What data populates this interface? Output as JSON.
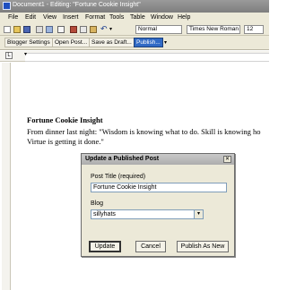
{
  "window": {
    "title": "Document1 - Editing: \"Fortune Cookie Insight\""
  },
  "menu": {
    "items": [
      "File",
      "Edit",
      "View",
      "Insert",
      "Format",
      "Tools",
      "Table",
      "Window",
      "Help"
    ]
  },
  "format_toolbar": {
    "style": "Normal",
    "font": "Times New Roman",
    "size": "12"
  },
  "blogger_toolbar": {
    "settings_label": "Blogger Settings",
    "open_label": "Open Post...",
    "save_draft_label": "Save as Draft...",
    "publish_label": "Publish..."
  },
  "document": {
    "heading": "Fortune Cookie Insight",
    "line1": "From dinner last night: \"Wisdom is knowing what to do. Skill is knowing ho",
    "line2": "Virtue is getting it done.\""
  },
  "dialog": {
    "title": "Update a Published Post",
    "post_title_label": "Post Title (required)",
    "post_title_value": "Fortune Cookie Insight",
    "blog_label": "Blog",
    "blog_value": "sillyhats",
    "update_label": "Update",
    "cancel_label": "Cancel",
    "publish_new_label": "Publish As New"
  }
}
